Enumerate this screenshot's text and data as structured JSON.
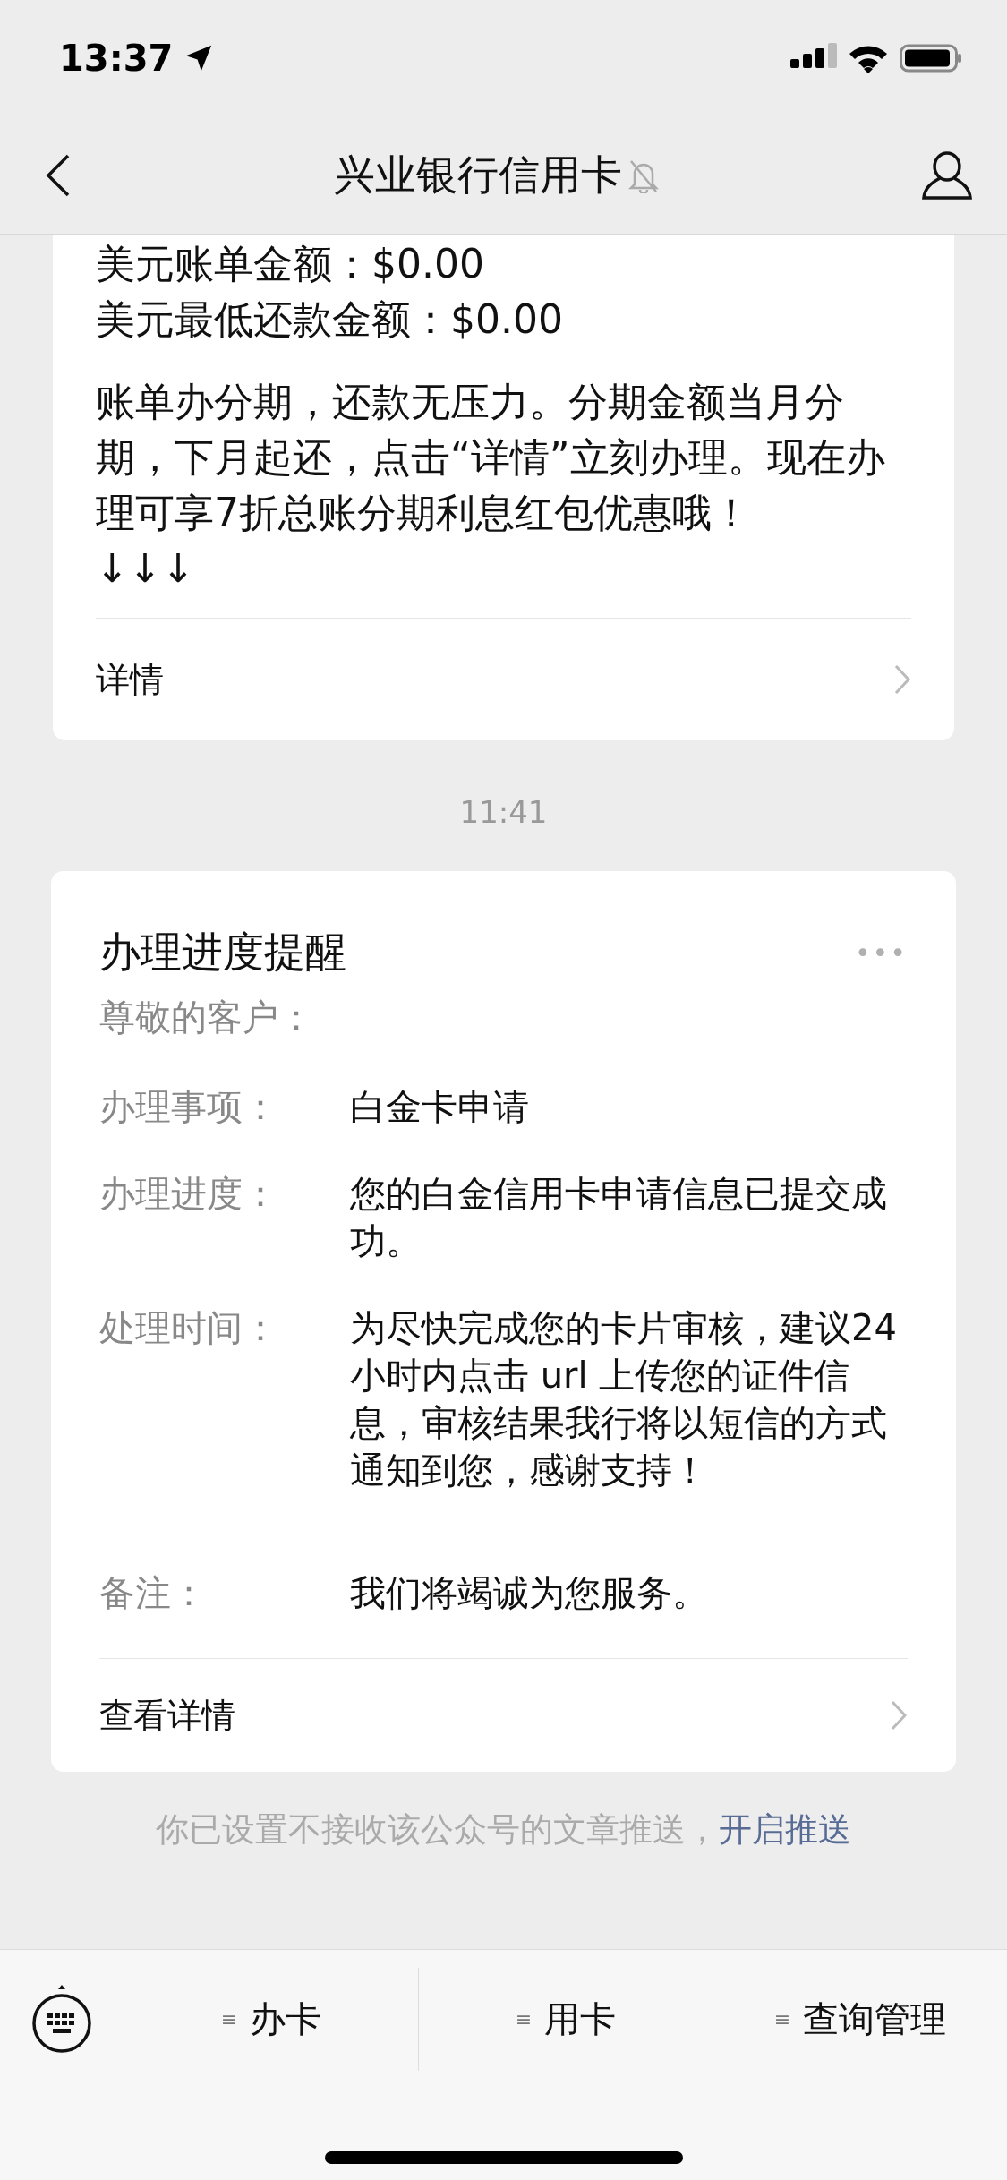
{
  "status_bar": {
    "time": "13:37"
  },
  "header": {
    "title": "兴业银行信用卡",
    "muted": true
  },
  "messages": [
    {
      "kind": "bill",
      "lines": [
        "美元账单金额：$0.00",
        "美元最低还款金额：$0.00"
      ],
      "paragraph": "账单办分期，还款无压力。分期金额当月分期，下月起还，点击“详情”立刻办理。现在办理可享7折总账分期利息红包优惠哦！",
      "arrows": "↓↓↓",
      "link": "详情"
    },
    {
      "kind": "time",
      "text": "11:41"
    },
    {
      "kind": "template",
      "title": "办理进度提醒",
      "greeting": "尊敬的客户：",
      "more": "•••",
      "rows": [
        {
          "label": "办理事项：",
          "value": "白金卡申请"
        },
        {
          "label": "办理进度：",
          "value": "您的白金信用卡申请信息已提交成功。"
        },
        {
          "label": "处理时间：",
          "value": "为尽快完成您的卡片审核，建议24小时内点击 url 上传您的证件信息，审核结果我行将以短信的方式通知到您，感谢支持！"
        },
        {
          "label": "备注：",
          "value": "我们将竭诚为您服务。"
        }
      ],
      "link": "查看详情"
    }
  ],
  "notice": {
    "text": "你已设置不接收该公众号的文章推送，",
    "link": "开启推送"
  },
  "menu": [
    {
      "icon": "≡",
      "label": "办卡"
    },
    {
      "icon": "≡",
      "label": "用卡"
    },
    {
      "icon": "≡",
      "label": "查询管理"
    }
  ]
}
